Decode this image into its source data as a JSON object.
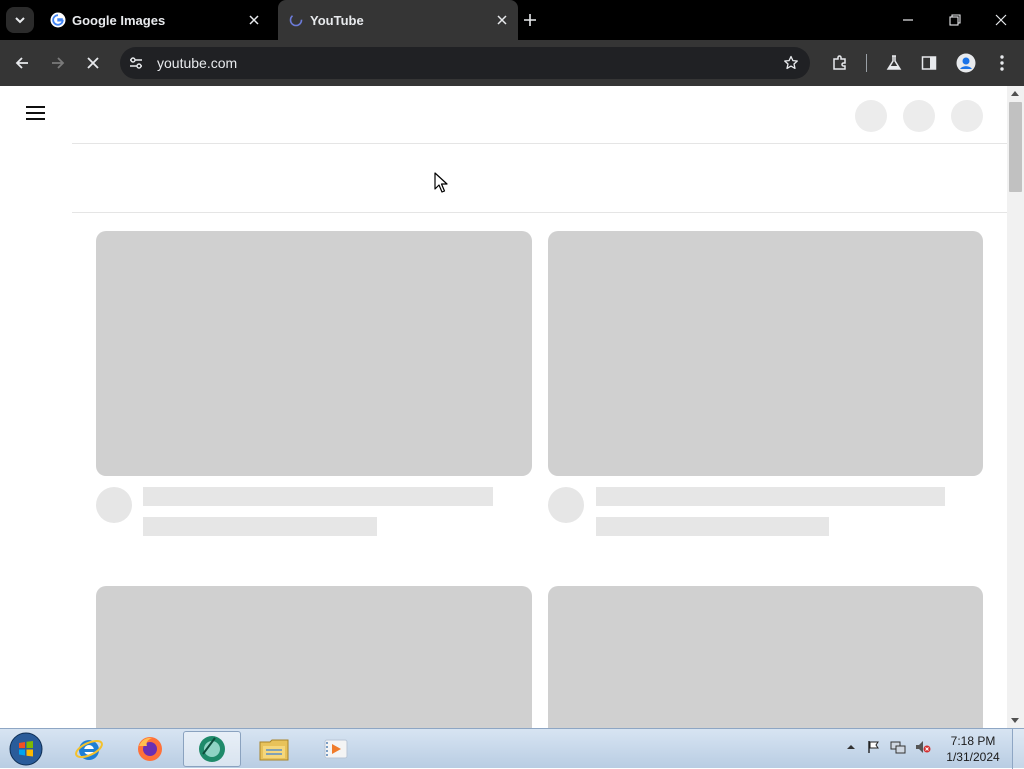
{
  "browser": {
    "tabs": [
      {
        "title": "Google Images",
        "active": false,
        "favicon": "google-g-icon"
      },
      {
        "title": "YouTube",
        "active": true,
        "favicon": "loading-icon"
      }
    ],
    "address": {
      "url": "youtube.com"
    },
    "loading": true
  },
  "page": {
    "state": "loading-skeleton"
  },
  "taskbar": {
    "apps": [
      "internet-explorer",
      "firefox",
      "chrome",
      "file-explorer",
      "media-player"
    ],
    "clock": {
      "time": "7:18 PM",
      "date": "1/31/2024"
    }
  },
  "colors": {
    "chrome_dark": "#000000",
    "toolbar": "#353535",
    "skeleton": "#d0d0d0",
    "skeleton_light": "#e6e6e6"
  }
}
